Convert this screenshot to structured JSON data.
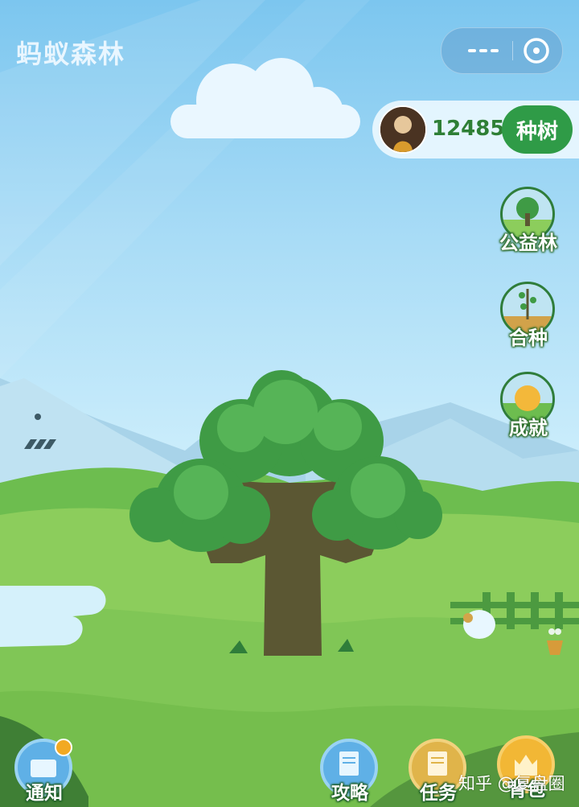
{
  "header": {
    "title": "蚂蚁森林"
  },
  "capsule": {
    "more_icon": "more-icon",
    "close_icon": "close-target-icon"
  },
  "energy": {
    "value": "12485g",
    "plant_button": "种树"
  },
  "side_menu": [
    {
      "label": "公益林",
      "icon": "forest-icon"
    },
    {
      "label": "合种",
      "icon": "sapling-icon"
    },
    {
      "label": "成就",
      "icon": "sun-trophy-icon"
    }
  ],
  "bottom_bar": [
    {
      "label": "通知",
      "icon": "message-icon",
      "has_badge": true
    },
    {
      "label": "攻略",
      "icon": "guide-book-icon"
    },
    {
      "label": "任务",
      "icon": "task-list-icon"
    },
    {
      "label": "背包",
      "icon": "bag-icon"
    }
  ],
  "watermark": "知乎 @复盘圈",
  "colors": {
    "sky": "#a9dcf6",
    "grass": "#7cc95a",
    "tree": "#3f9b45",
    "trunk": "#5b5733",
    "button": "#2f9b47"
  }
}
